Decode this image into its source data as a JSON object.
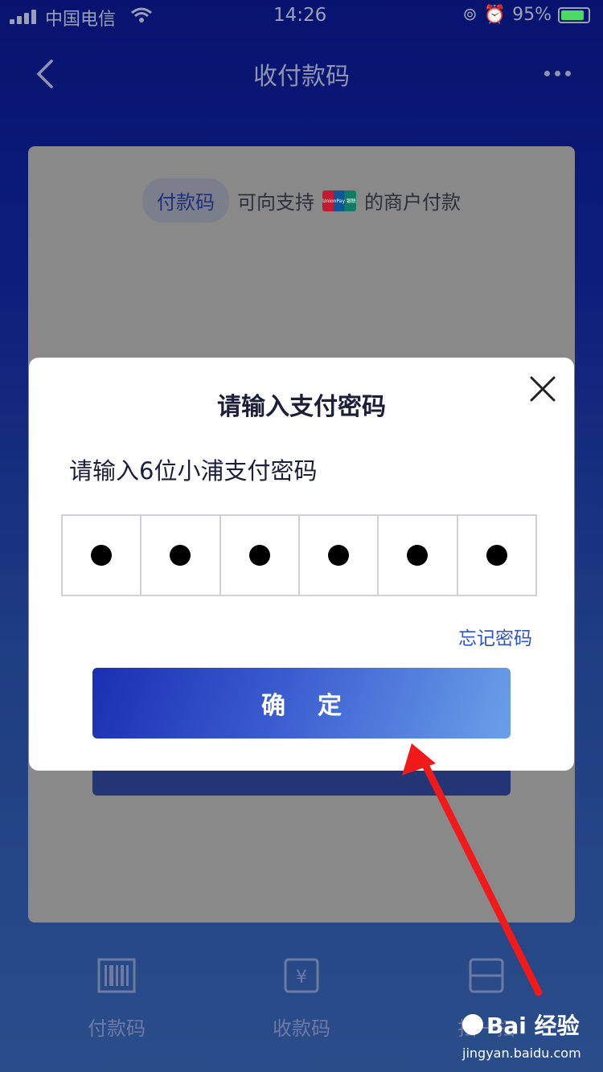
{
  "status_bar": {
    "carrier": "中国电信",
    "time": "14:26",
    "battery": "95%"
  },
  "nav": {
    "title": "收付款码"
  },
  "card": {
    "pill": "付款码",
    "text1": "可向支持",
    "text2": "的商户付款",
    "unionpay_text": "UnionPay 银联"
  },
  "tabs": [
    {
      "label": "付款码",
      "icon": "barcode-icon"
    },
    {
      "label": "收款码",
      "icon": "yuan-receive-icon"
    },
    {
      "label": "扫一扫",
      "icon": "scan-icon"
    }
  ],
  "dialog": {
    "title": "请输入支付密码",
    "subtitle": "请输入6位小浦支付密码",
    "pin_filled": 6,
    "forgot": "忘记密码",
    "confirm": "确定"
  },
  "watermark": {
    "brand": "Bai 经验",
    "site": "jingyan.baidu.com"
  },
  "colors": {
    "accent": "#2f54c4",
    "annotation_arrow": "#f01a1a"
  }
}
